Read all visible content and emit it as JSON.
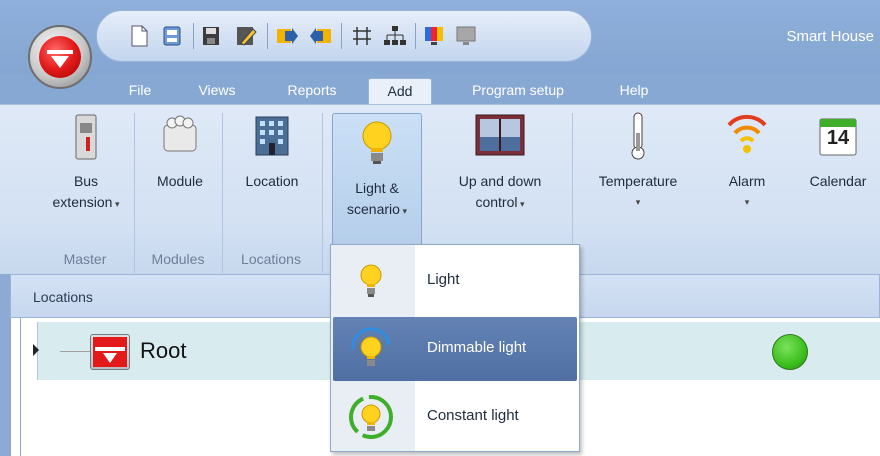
{
  "window": {
    "title": "Smart House"
  },
  "tabs": [
    {
      "label": "File"
    },
    {
      "label": "Views"
    },
    {
      "label": "Reports"
    },
    {
      "label": "Add"
    },
    {
      "label": "Program setup"
    },
    {
      "label": "Help"
    }
  ],
  "ribbon": {
    "bus_extension": {
      "line1": "Bus",
      "line2": "extension"
    },
    "module": {
      "label": "Module"
    },
    "location": {
      "label": "Location"
    },
    "light_scenario": {
      "line1": "Light &",
      "line2": "scenario"
    },
    "up_down": {
      "line1": "Up and down",
      "line2": "control"
    },
    "temperature": {
      "label": "Temperature"
    },
    "alarm": {
      "label": "Alarm"
    },
    "calendar": {
      "label": "Calendar",
      "day": "14"
    },
    "groups": {
      "master": "Master",
      "modules": "Modules",
      "locations": "Locations"
    }
  },
  "panel": {
    "title": "Locations",
    "root_label": "Root",
    "status_color": "#3cbf1e"
  },
  "dropdown": {
    "items": [
      {
        "label": "Light",
        "icon": "bulb-icon"
      },
      {
        "label": "Dimmable light",
        "icon": "dimmable-bulb-icon"
      },
      {
        "label": "Constant light",
        "icon": "constant-bulb-icon"
      }
    ],
    "highlighted": "Dimmable light"
  },
  "colors": {
    "accent": "#88a8d4",
    "brand_red": "#e31a1a"
  }
}
